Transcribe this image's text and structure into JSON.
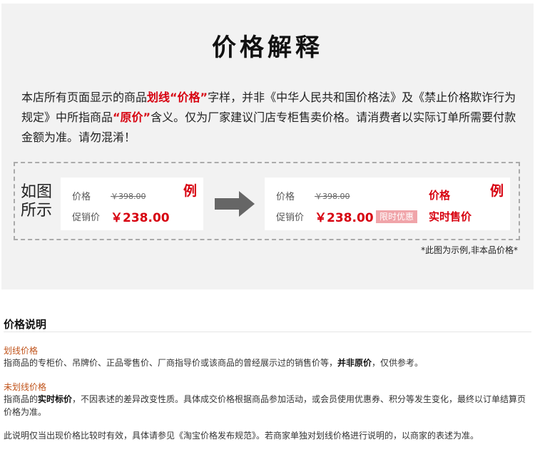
{
  "banner": {
    "title": "价格解释",
    "intro": {
      "p1": "本店所有页面显示的商品",
      "p2": "划线“价格”",
      "p3": "字样，并非《中华人民共和国价格法》及《禁止价格欺诈行为规定》中所指商品",
      "p4": "“原价”",
      "p5": "含义。仅为厂家建议门店专柜售卖价格。请消费者以实际订单所需要付款金额为准。请勿混淆！"
    },
    "example": {
      "caption": "如图所示",
      "left_card": {
        "price_label": "价格",
        "original_price": "￥398.00",
        "promo_label": "促销价",
        "promo_price": "￥238.00",
        "tag": "例"
      },
      "right_card": {
        "price_label": "价格",
        "original_price": "￥398.00",
        "promo_label": "促销价",
        "promo_price": "￥238.00",
        "badge": "限时优惠",
        "note_price": "价格",
        "note_realtime": "实时售价",
        "tag": "例"
      },
      "arrow_icon": "right-arrow-icon"
    },
    "sample_note": "*此图为示例,非本品价格*"
  },
  "explanation": {
    "title": "价格说明",
    "strikethrough_heading": "划线价格",
    "strikethrough_text_a": "指商品的专柜价、吊牌价、正品零售价、厂商指导价或该商品的曾经展示过的销售价等，",
    "strikethrough_text_bold": "并非原价",
    "strikethrough_text_b": "，仅供参考。",
    "nonstrike_heading": "未划线价格",
    "nonstrike_text_a": "指商品的",
    "nonstrike_text_bold": "实时标价",
    "nonstrike_text_b": "，不因表述的差异改变性质。具体成交价格根据商品参加活动，或会员使用优惠券、积分等发生变化，最终以订单结算页价格为准。",
    "footer": "此说明仅当出现价格比较时有效，具体请参见《淘宝价格发布规范》。若商家单独对划线价格进行说明的，以商家的表述为准。"
  },
  "colors": {
    "accent_red": "#d7000f",
    "banner_bg": "#f2f2f2",
    "heading_orange": "#c0531a",
    "badge_pink": "#f0a4a9"
  }
}
